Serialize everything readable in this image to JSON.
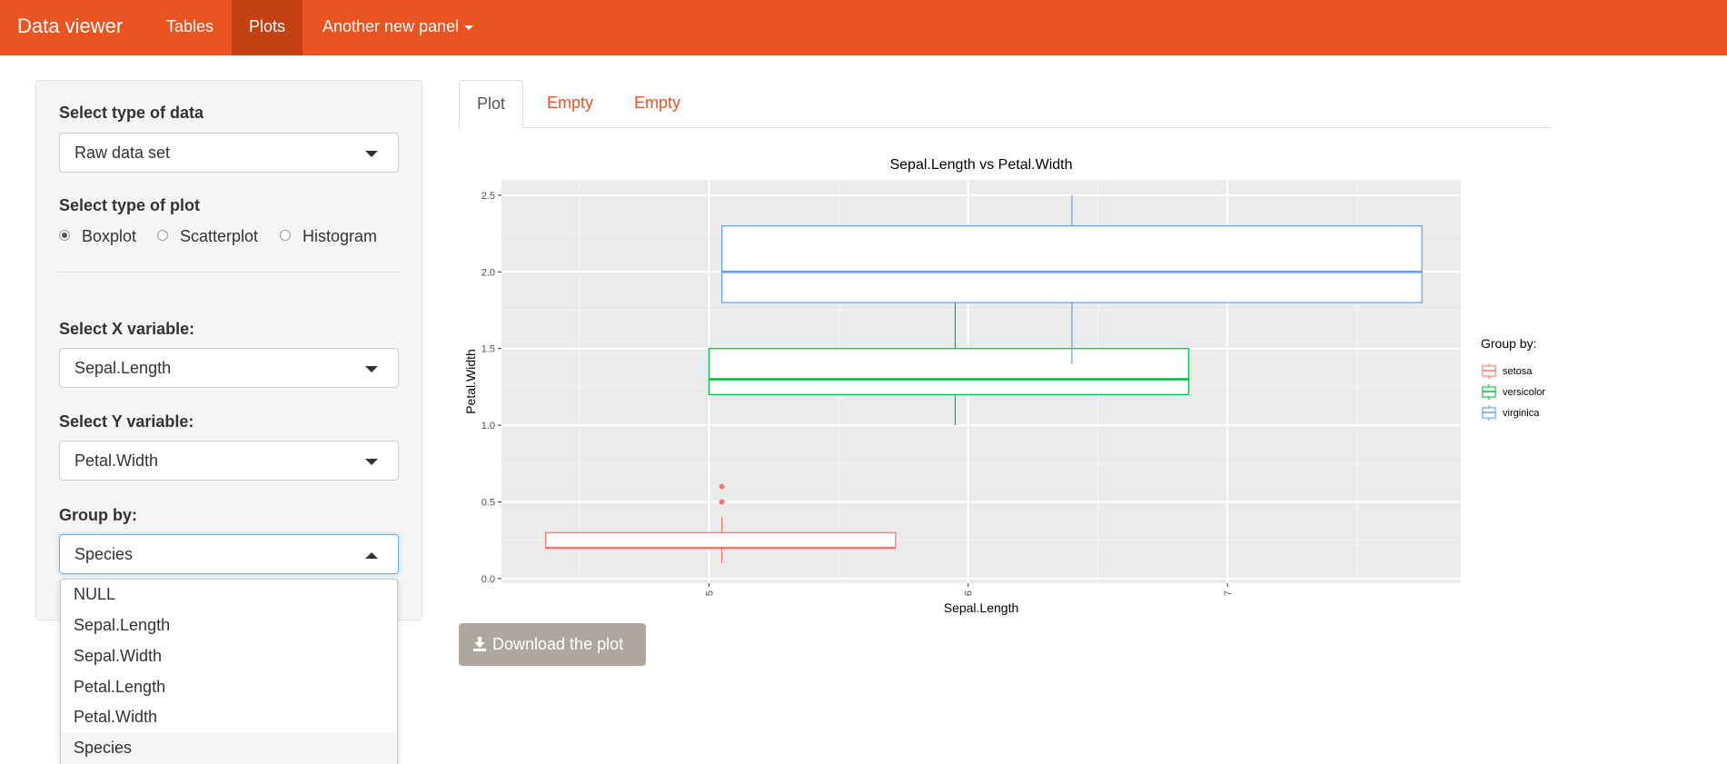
{
  "navbar": {
    "brand": "Data viewer",
    "items": [
      {
        "label": "Tables",
        "active": false
      },
      {
        "label": "Plots",
        "active": true
      },
      {
        "label": "Another new panel",
        "dropdown": true
      }
    ],
    "color": "#e95420",
    "active_color": "#c34113"
  },
  "sidebar": {
    "data_type": {
      "label": "Select type of data",
      "value": "Raw data set"
    },
    "plot_type": {
      "label": "Select type of plot",
      "options": [
        "Boxplot",
        "Scatterplot",
        "Histogram"
      ],
      "selected": "Boxplot"
    },
    "x_variable": {
      "label": "Select X variable:",
      "value": "Sepal.Length"
    },
    "y_variable": {
      "label": "Select Y variable:",
      "value": "Petal.Width"
    },
    "group_by": {
      "label": "Group by:",
      "value": "Species",
      "open": true,
      "options": [
        "NULL",
        "Sepal.Length",
        "Sepal.Width",
        "Petal.Length",
        "Petal.Width",
        "Species"
      ]
    }
  },
  "tabs": [
    {
      "label": "Plot",
      "active": true
    },
    {
      "label": "Empty",
      "active": false
    },
    {
      "label": "Empty",
      "active": false
    }
  ],
  "chart_data": {
    "type": "boxplot",
    "title": "Sepal.Length vs Petal.Width",
    "xlabel": "Sepal.Length",
    "ylabel": "Petal.Width",
    "x_ticks": [
      "5",
      "6",
      "7"
    ],
    "y_ticks": [
      "0.0",
      "0.5",
      "1.0",
      "1.5",
      "2.0",
      "2.5"
    ],
    "xlim": [
      4.2,
      7.9
    ],
    "ylim": [
      -0.03,
      2.6
    ],
    "legend_title": "Group by:",
    "legend_position": "right",
    "series": [
      {
        "name": "setosa",
        "color": "#f8766d",
        "x_low": 4.37,
        "x_high": 5.72,
        "x_center": 5.05,
        "whisker_low": 0.1,
        "q1": 0.2,
        "median": 0.2,
        "q3": 0.3,
        "whisker_high": 0.4,
        "outliers": [
          0.5,
          0.6
        ]
      },
      {
        "name": "versicolor",
        "color": "#00ba38",
        "x_low": 5.0,
        "x_high": 6.85,
        "x_center": 5.95,
        "whisker_low": 1.0,
        "q1": 1.2,
        "median": 1.3,
        "q3": 1.5,
        "whisker_high": 1.8,
        "outliers": []
      },
      {
        "name": "virginica",
        "color": "#619cff",
        "x_low": 5.05,
        "x_high": 7.75,
        "x_center": 6.4,
        "whisker_low": 1.4,
        "q1": 1.8,
        "median": 2.0,
        "q3": 2.3,
        "whisker_high": 2.5,
        "outliers": []
      }
    ]
  },
  "download": {
    "label": "Download the plot",
    "icon": "download-icon",
    "color": "#aea79f"
  }
}
